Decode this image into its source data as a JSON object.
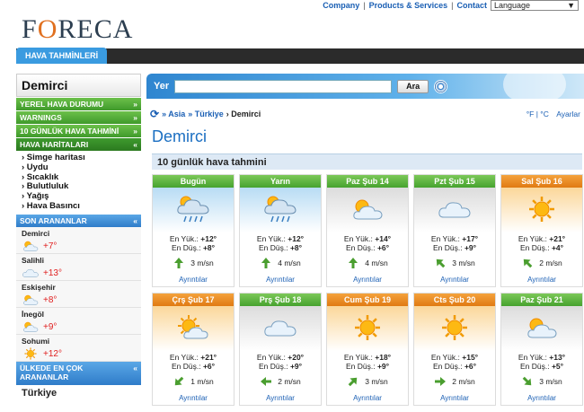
{
  "topnav": {
    "company": "Company",
    "products": "Products & Services",
    "contact": "Contact",
    "language": "Language"
  },
  "logo": {
    "pre": "F",
    "o": "O",
    "post": "RECA"
  },
  "tab": {
    "label": "HAVA TAHMİNLERİ"
  },
  "sidebar": {
    "title": "Demirci",
    "menu": [
      {
        "label": "YEREL HAVA DURUMU",
        "mark": "»"
      },
      {
        "label": "WARNINGS",
        "mark": "»"
      },
      {
        "label": "10 GÜNLÜK HAVA TAHMİNİ",
        "mark": "»"
      },
      {
        "label": "HAVA HARİTALARI",
        "mark": "«"
      }
    ],
    "maps": [
      "› Simge haritası",
      "› Uydu",
      "› Sıcaklık",
      "› Bulutluluk",
      "› Yağış",
      "› Hava Basıncı"
    ],
    "recent_title": "SON ARANANLAR",
    "recent": [
      {
        "name": "Demirci",
        "temp": "+7°",
        "icon": "partly-cloudy-icon"
      },
      {
        "name": "Salihli",
        "temp": "+13°",
        "icon": "cloud-icon"
      },
      {
        "name": "Eskişehir",
        "temp": "+8°",
        "icon": "partly-cloudy-icon"
      },
      {
        "name": "İnegöl",
        "temp": "+9°",
        "icon": "partly-cloudy-icon"
      },
      {
        "name": "Sohumi",
        "temp": "+12°",
        "icon": "sun-icon"
      }
    ],
    "top_title": "ÜLKEDE EN ÇOK ARANANLAR",
    "country": "Türkiye"
  },
  "search": {
    "label": "Yer",
    "button": "Ara",
    "value": ""
  },
  "breadcrumb": {
    "items": [
      "» Asia",
      "» Türkiye",
      "› Demirci"
    ],
    "units": "°F | °C",
    "settings": "Ayarlar"
  },
  "page_title": "Demirci",
  "section": "10 günlük hava tahmini",
  "forecast": [
    {
      "day": "Bugün",
      "hi": "+12°",
      "lo": "+8°",
      "wind": "3 m/sn",
      "icon": "rain-cloud-icon",
      "sky": "blue",
      "warm": false,
      "rot": 0
    },
    {
      "day": "Yarın",
      "hi": "+12°",
      "lo": "+8°",
      "wind": "4 m/sn",
      "icon": "rain-cloud-icon",
      "sky": "blue",
      "warm": false,
      "rot": 0
    },
    {
      "day": "Paz Şub 14",
      "hi": "+14°",
      "lo": "+6°",
      "wind": "4 m/sn",
      "icon": "partly-cloudy-icon",
      "sky": "grey",
      "warm": false,
      "rot": 0
    },
    {
      "day": "Pzt Şub 15",
      "hi": "+17°",
      "lo": "+9°",
      "wind": "3 m/sn",
      "icon": "cloud-icon",
      "sky": "grey",
      "warm": false,
      "rot": -45
    },
    {
      "day": "Sal Şub 16",
      "hi": "+21°",
      "lo": "+4°",
      "wind": "2 m/sn",
      "icon": "sun-icon",
      "sky": "orange",
      "warm": true,
      "rot": -45
    },
    {
      "day": "Çrş Şub 17",
      "hi": "+21°",
      "lo": "+6°",
      "wind": "1 m/sn",
      "icon": "partly-sunny-icon",
      "sky": "orange",
      "warm": true,
      "rot": -135
    },
    {
      "day": "Prş Şub 18",
      "hi": "+20°",
      "lo": "+9°",
      "wind": "2 m/sn",
      "icon": "cloud-icon",
      "sky": "grey",
      "warm": false,
      "rot": -90
    },
    {
      "day": "Cum Şub 19",
      "hi": "+18°",
      "lo": "+9°",
      "wind": "3 m/sn",
      "icon": "sun-icon",
      "sky": "orange",
      "warm": true,
      "rot": 45
    },
    {
      "day": "Cts Şub 20",
      "hi": "+15°",
      "lo": "+6°",
      "wind": "2 m/sn",
      "icon": "sun-icon",
      "sky": "orange",
      "warm": true,
      "rot": 90
    },
    {
      "day": "Paz Şub 21",
      "hi": "+13°",
      "lo": "+5°",
      "wind": "3 m/sn",
      "icon": "partly-cloudy-icon",
      "sky": "grey",
      "warm": false,
      "rot": 135
    }
  ],
  "labels": {
    "hi": "En Yük.:",
    "lo": "En Düş.:",
    "details": "Ayrıntılar"
  }
}
